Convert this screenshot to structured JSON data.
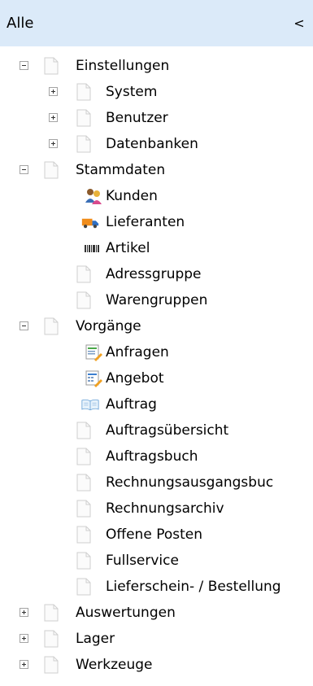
{
  "header": {
    "title": "Alle",
    "collapse_glyph": "<"
  },
  "tree": {
    "einstellungen": {
      "label": "Einstellungen",
      "children": {
        "system": "System",
        "benutzer": "Benutzer",
        "datenbanken": "Datenbanken"
      }
    },
    "stammdaten": {
      "label": "Stammdaten",
      "children": {
        "kunden": "Kunden",
        "lieferanten": "Lieferanten",
        "artikel": "Artikel",
        "adressgruppe": "Adressgruppe",
        "warengruppen": "Warengruppen"
      }
    },
    "vorgaenge": {
      "label": "Vorgänge",
      "children": {
        "anfragen": "Anfragen",
        "angebot": "Angebot",
        "auftrag": "Auftrag",
        "auftragsuebersicht": "Auftragsübersicht",
        "auftragsbuch": "Auftragsbuch",
        "rechnungsausgangsbuch": "Rechnungsausgangsbuc",
        "rechnungsarchiv": "Rechnungsarchiv",
        "offene_posten": "Offene Posten",
        "fullservice": "Fullservice",
        "lieferschein": "Lieferschein- / Bestellung"
      }
    },
    "auswertungen": {
      "label": "Auswertungen"
    },
    "lager": {
      "label": "Lager"
    },
    "werkzeuge": {
      "label": "Werkzeuge"
    }
  }
}
